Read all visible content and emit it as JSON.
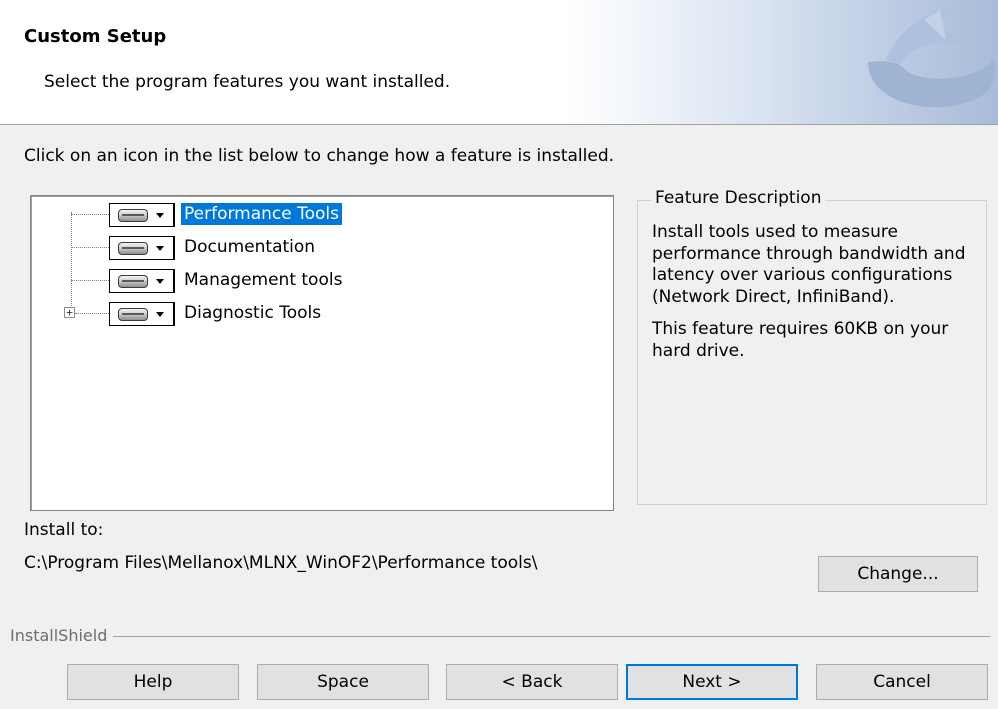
{
  "header": {
    "title": "Custom Setup",
    "subtitle": "Select the program features you want installed.",
    "logo_icon": "installshield-logo-icon"
  },
  "instruction": "Click on an icon in the list below to change how a feature is installed.",
  "features": [
    {
      "label": "Performance Tools",
      "icon": "hard-drive-icon",
      "selected": true,
      "expandable": false
    },
    {
      "label": "Documentation",
      "icon": "hard-drive-icon",
      "selected": false,
      "expandable": false
    },
    {
      "label": "Management tools",
      "icon": "hard-drive-icon",
      "selected": false,
      "expandable": false
    },
    {
      "label": "Diagnostic Tools",
      "icon": "hard-drive-icon",
      "selected": false,
      "expandable": true
    }
  ],
  "expander_symbol": "+",
  "description": {
    "legend": "Feature Description",
    "text": "Install tools used to measure performance through bandwidth and latency over various configurations (Network Direct, InfiniBand).",
    "requirement": "This feature requires 60KB on your hard drive."
  },
  "install": {
    "label": "Install to:",
    "path": "C:\\Program Files\\Mellanox\\MLNX_WinOF2\\Performance tools\\"
  },
  "buttons": {
    "change": "Change...",
    "help": "Help",
    "space": "Space",
    "back": "< Back",
    "next": "Next >",
    "cancel": "Cancel"
  },
  "brand": "InstallShield",
  "colors": {
    "selection": "#0078d7",
    "button_face": "#e1e1e1",
    "dialog_bg": "#f0f0f0"
  }
}
